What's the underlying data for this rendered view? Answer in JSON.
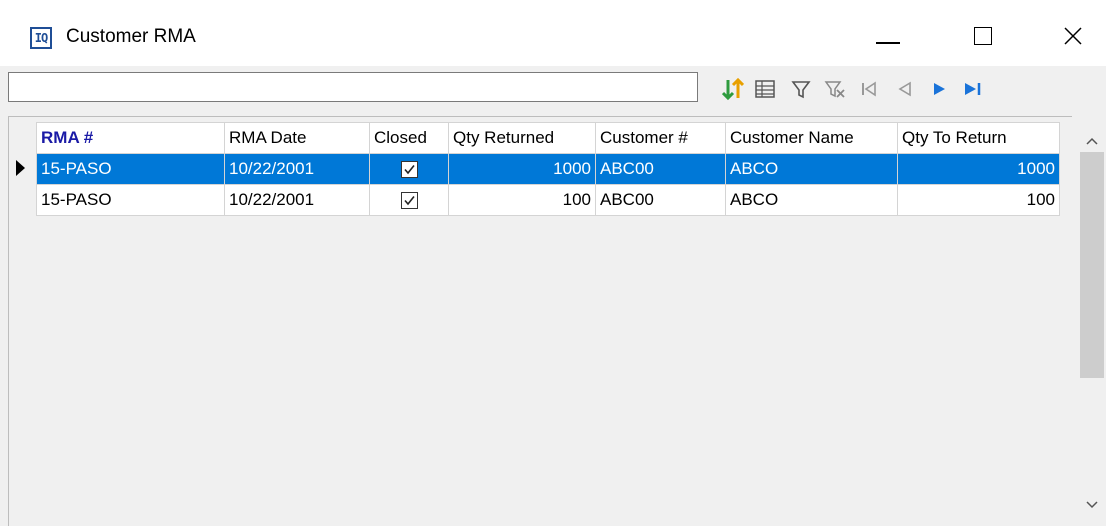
{
  "window": {
    "app_icon_text": "IQ",
    "title": "Customer RMA"
  },
  "toolbar": {
    "search_value": "",
    "icons": [
      "sort-icon",
      "grid-view-icon",
      "filter-icon",
      "clear-filter-icon",
      "first-record-icon",
      "previous-record-icon",
      "next-record-icon",
      "last-record-icon"
    ]
  },
  "grid": {
    "columns": [
      "RMA #",
      "RMA Date",
      "Closed",
      "Qty Returned",
      "Customer #",
      "Customer Name",
      "Qty To Return"
    ],
    "rows": [
      {
        "rma": "15-PASO",
        "rma_date": "10/22/2001",
        "closed": true,
        "qty_returned": "1000",
        "customer_no": "ABC00",
        "customer_name": "ABCO",
        "qty_to_return": "1000",
        "selected": true
      },
      {
        "rma": "15-PASO",
        "rma_date": "10/22/2001",
        "closed": true,
        "qty_returned": "100",
        "customer_no": "ABC00",
        "customer_name": "ABCO",
        "qty_to_return": "100",
        "selected": false
      }
    ]
  },
  "colors": {
    "selection": "#0078d7",
    "sort_header": "#1a1aa6",
    "nav_active": "#1a73d9",
    "sort_icon_green": "#2e9b3e"
  }
}
